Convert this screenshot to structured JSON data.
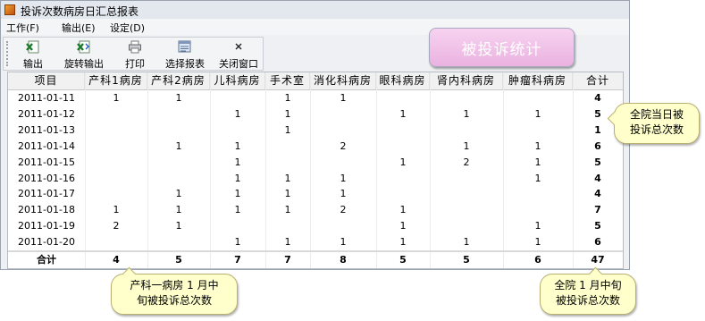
{
  "window": {
    "title": "投诉次数病房日汇总报表"
  },
  "menu": [
    "工作(F)",
    "输出(E)",
    "设定(D)"
  ],
  "toolbar": {
    "export": "输出",
    "rotate_export": "旋转输出",
    "print": "打印",
    "select_report": "选择报表",
    "close_window": "关闭窗口"
  },
  "banner": "被投诉统计",
  "table": {
    "headers": [
      "项目",
      "产科1病房",
      "产科2病房",
      "儿科病房",
      "手术室",
      "消化科病房",
      "眼科病房",
      "肾内科病房",
      "肿瘤科病房",
      "合计"
    ],
    "rows": [
      [
        "2011-01-11",
        "1",
        "1",
        "",
        "1",
        "1",
        "",
        "",
        "",
        "4"
      ],
      [
        "2011-01-12",
        "",
        "",
        "1",
        "1",
        "",
        "1",
        "1",
        "1",
        "5"
      ],
      [
        "2011-01-13",
        "",
        "",
        "",
        "1",
        "",
        "",
        "",
        "",
        "1"
      ],
      [
        "2011-01-14",
        "",
        "1",
        "1",
        "",
        "2",
        "",
        "1",
        "1",
        "6"
      ],
      [
        "2011-01-15",
        "",
        "",
        "1",
        "",
        "",
        "1",
        "2",
        "1",
        "5"
      ],
      [
        "2011-01-16",
        "",
        "",
        "1",
        "1",
        "1",
        "",
        "",
        "1",
        "4"
      ],
      [
        "2011-01-17",
        "",
        "1",
        "1",
        "1",
        "1",
        "",
        "",
        "",
        "4"
      ],
      [
        "2011-01-18",
        "1",
        "1",
        "1",
        "1",
        "2",
        "1",
        "",
        "",
        "7"
      ],
      [
        "2011-01-19",
        "2",
        "1",
        "",
        "",
        "",
        "1",
        "",
        "1",
        "5"
      ],
      [
        "2011-01-20",
        "",
        "",
        "1",
        "1",
        "1",
        "1",
        "1",
        "1",
        "6"
      ]
    ],
    "totals": [
      "合计",
      "4",
      "5",
      "7",
      "7",
      "8",
      "5",
      "5",
      "6",
      "47"
    ]
  },
  "callouts": {
    "daily_total": [
      "全院当日被",
      "投诉总次数"
    ],
    "ward_total": [
      "产科一病房 1 月中",
      "旬被投诉总次数"
    ],
    "grand_total": [
      "全院 1 月中旬",
      "被投诉总次数"
    ]
  }
}
